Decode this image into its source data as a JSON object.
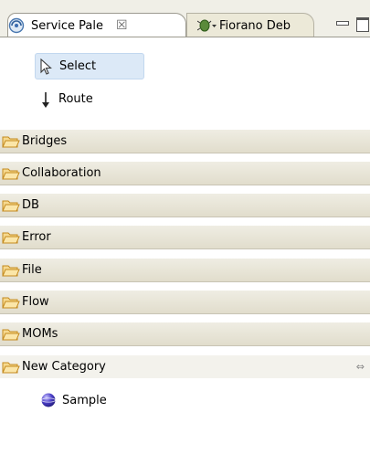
{
  "tabs": {
    "active_label": "Service Pale",
    "active_close": "☒",
    "inactive_label": "Fiorano Deb"
  },
  "tools": [
    {
      "label": "Select",
      "icon": "arrow-pointer-icon",
      "selected": true
    },
    {
      "label": "Route",
      "icon": "down-arrow-icon",
      "selected": false
    }
  ],
  "drawers": [
    {
      "label": "Bridges"
    },
    {
      "label": "Collaboration"
    },
    {
      "label": "DB"
    },
    {
      "label": "Error"
    },
    {
      "label": "File"
    },
    {
      "label": "Flow"
    },
    {
      "label": "MOMs"
    },
    {
      "label": "New Category",
      "open": true
    }
  ],
  "drawer_pin": "⇔",
  "entries": [
    {
      "label": "Sample",
      "icon": "sphere-icon"
    }
  ],
  "colors": {
    "selection": "#dce9f7",
    "drawer_bg": "#e8e5d6",
    "folder": "#e6a93b"
  }
}
